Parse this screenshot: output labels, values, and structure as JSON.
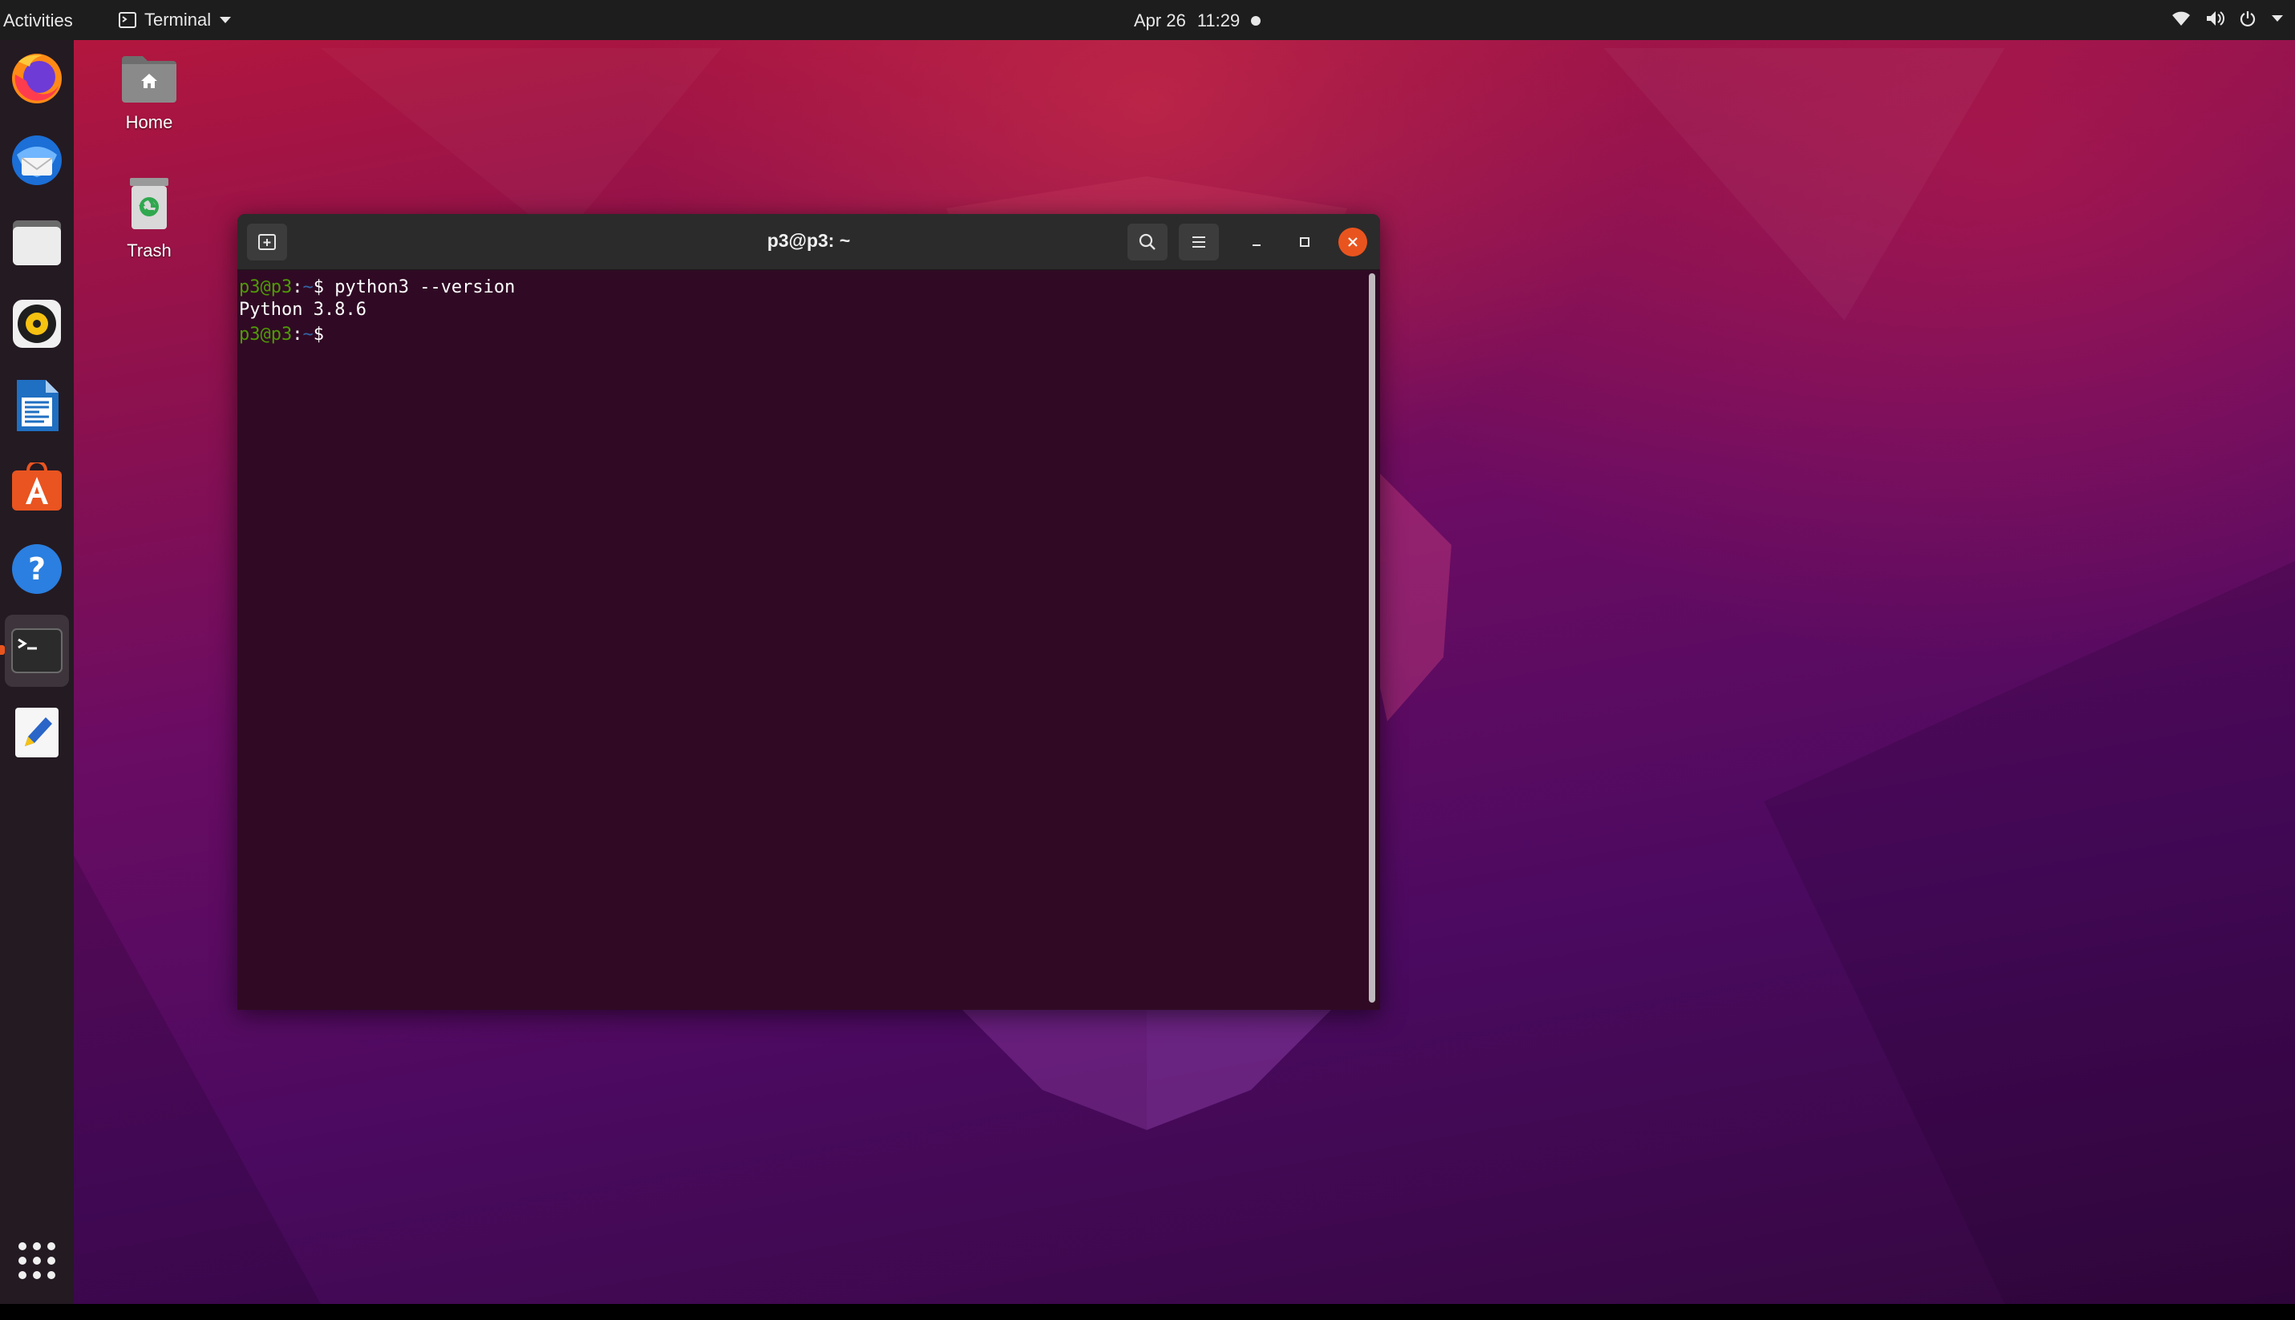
{
  "topbar": {
    "activities": "Activities",
    "app_name": "Terminal",
    "date": "Apr 26",
    "time": "11:29",
    "tray_icons": [
      "wifi-icon",
      "volume-icon",
      "power-icon",
      "chevron-down-icon"
    ]
  },
  "dock": {
    "items": [
      {
        "name": "Firefox",
        "icon": "firefox-icon"
      },
      {
        "name": "Thunderbird",
        "icon": "thunderbird-icon"
      },
      {
        "name": "Files",
        "icon": "files-icon"
      },
      {
        "name": "Rhythmbox",
        "icon": "rhythmbox-icon"
      },
      {
        "name": "LibreOffice Writer",
        "icon": "writer-icon"
      },
      {
        "name": "Ubuntu Software",
        "icon": "software-icon"
      },
      {
        "name": "Help",
        "icon": "help-icon"
      },
      {
        "name": "Terminal",
        "icon": "terminal-icon",
        "active": true
      },
      {
        "name": "Text Editor",
        "icon": "text-editor-icon"
      }
    ],
    "apps_grid": "show-apps-icon"
  },
  "desktop_icons": {
    "home": "Home",
    "trash": "Trash"
  },
  "terminal": {
    "title": "p3@p3: ~",
    "lines": [
      {
        "user": "p3@p3",
        "path": "~",
        "symbol": "$",
        "command": "python3 --version"
      },
      {
        "output": "Python 3.8.6"
      },
      {
        "user": "p3@p3",
        "path": "~",
        "symbol": "$",
        "command": ""
      }
    ]
  },
  "colors": {
    "prompt_user": "#4e9a06",
    "prompt_path": "#3465a4",
    "terminal_bg": "#300a24",
    "close_button": "#e9541e",
    "topbar_bg": "#1d1d1d"
  }
}
